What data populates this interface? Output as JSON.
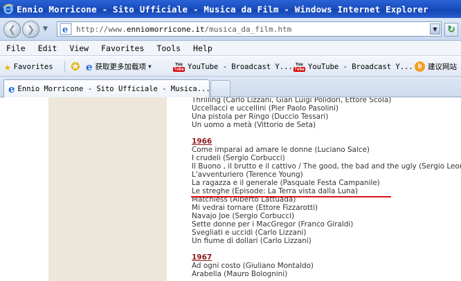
{
  "window": {
    "title": "Ennio Morricone - Sito Ufficiale - Musica da Film - Windows Internet Explorer"
  },
  "address": {
    "url_prefix": "http://www.",
    "url_host": "enniomorricone.it",
    "url_path": "/musica_da_film.htm"
  },
  "menu": [
    "File",
    "Edit",
    "View",
    "Favorites",
    "Tools",
    "Help"
  ],
  "favorites_bar": {
    "favorites_label": "Favorites",
    "items": [
      {
        "label": "获取更多加载项",
        "icon": "ie-icon"
      },
      {
        "label": "YouTube - Broadcast Y...",
        "icon": "youtube-icon"
      },
      {
        "label": "YouTube - Broadcast Y...",
        "icon": "youtube-icon"
      },
      {
        "label": "建议网站",
        "icon": "baidu-icon"
      }
    ]
  },
  "tabs": [
    {
      "label": "Ennio Morricone - Sito Ufficiale - Musica..."
    }
  ],
  "content": {
    "top_films": [
      "Thrilling (Carlo Lizzani, Gian Luigi Polidori, Ettore Scola)",
      "Uccellacci e uccellini (Pier Paolo Pasolini)",
      "Una pistola per Ringo (Duccio Tessari)",
      "Un uomo a metà (Vittorio de Seta)"
    ],
    "year_1966": "1966",
    "films_1966": [
      "Come imparai ad amare le donne (Luciano Salce)",
      "I crudeli (Sergio Corbucci)",
      "Il Buono , il brutto e il cattivo / The good, the bad and the ugly (Sergio Leone)",
      "L'avventuriero (Terence Young)",
      "La ragazza e il generale (Pasquale Festa Campanile)",
      "Le streghe (Episode: La Terra vista dalla Luna)",
      "Matchless (Alberto Lattuada)",
      "Mi vedrai tornare (Ettore Fizzarotti)",
      "Navajo Joe (Sergio Corbucci)",
      "Sette donne per i MacGregor (Franco Giraldi)",
      "Svegliati e uccidi (Carlo Lizzani)",
      "Un fiume di dollari (Carlo Lizzani)"
    ],
    "year_1967": "1967",
    "films_1967": [
      "Ad ogni costo (Giuliano Montaldo)",
      "Arabella (Mauro Bolognini)"
    ]
  },
  "colors": {
    "titlebar": "#1b4fc0",
    "year_link": "#8b1a1a",
    "highlight_underline": "#e01010",
    "sidebar_beige": "#ede7da"
  }
}
